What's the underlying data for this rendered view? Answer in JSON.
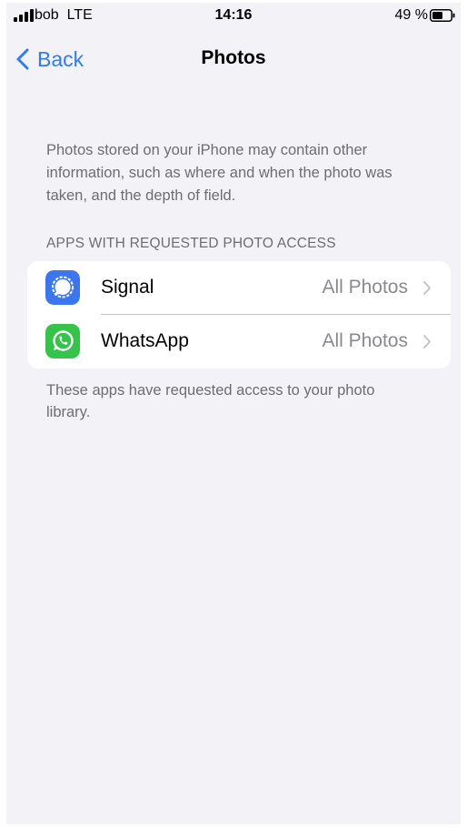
{
  "status_bar": {
    "carrier": "bob",
    "network": "LTE",
    "time": "14:16",
    "battery": "49 %",
    "signal_icon": "cellular-signal-icon",
    "battery_icon": "battery-icon",
    "battery_level": 0.49
  },
  "nav": {
    "back_label": "Back",
    "back_icon": "chevron-left-icon",
    "title": "Photos"
  },
  "description": "Photos stored on your iPhone may contain other information, such as where and when the photo was taken, and the depth of field.",
  "section": {
    "header": "APPS WITH REQUESTED PHOTO ACCESS",
    "items": [
      {
        "name": "Signal",
        "value": "All Photos",
        "icon": "signal-app-icon",
        "icon_color": "#3a76f0"
      },
      {
        "name": "WhatsApp",
        "value": "All Photos",
        "icon": "whatsapp-app-icon",
        "icon_color": "#33c449"
      }
    ],
    "footer": "These apps have requested access to your photo library."
  },
  "colors": {
    "accent": "#2f7cf6",
    "background": "#f2f2f7",
    "secondary_text": "#6d6d72"
  }
}
